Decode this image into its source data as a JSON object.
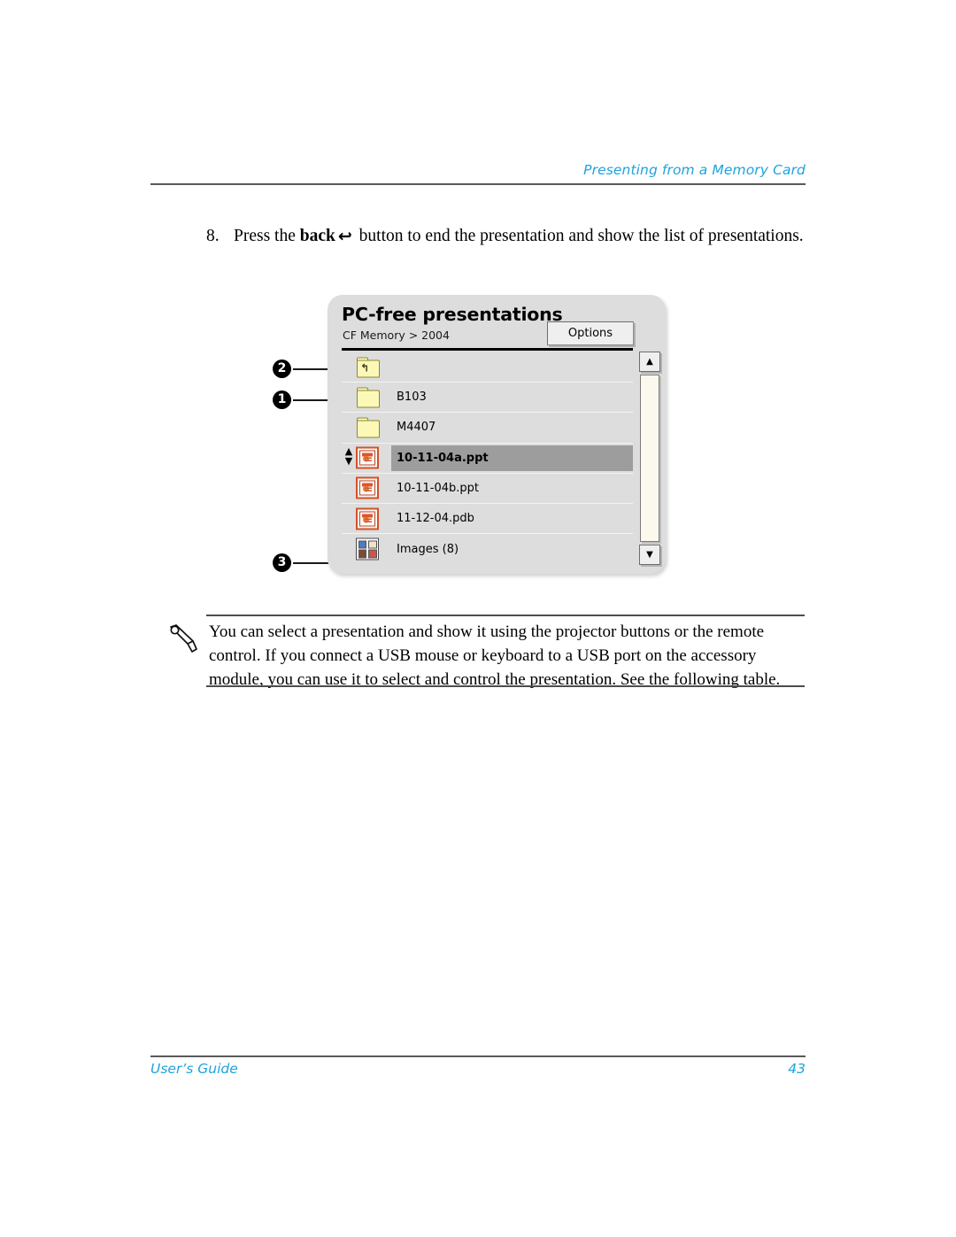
{
  "page": {
    "running_head": "Presenting from a Memory Card",
    "footer_left": "User’s Guide",
    "footer_page_number": "43",
    "accent_color": "#1fa3dd"
  },
  "step": {
    "number": "8.",
    "text_before": "Press the ",
    "bold_word": "back",
    "glyph": "↩",
    "icon_name": "back-arrow-icon",
    "text_after": " button to end the presentation and show the list of presentations."
  },
  "illustration": {
    "name": "pc-free-presentations-screen",
    "dialog": {
      "title": "PC-free presentations",
      "breadcrumb": "CF Memory > 2004",
      "options_button": "Options"
    },
    "callouts": [
      {
        "id": "1",
        "label": "❶",
        "target": "folder-row-b103"
      },
      {
        "id": "2",
        "label": "❷",
        "target": "parent-folder-row"
      },
      {
        "id": "3",
        "label": "❸",
        "target": "images-row"
      }
    ],
    "rows": [
      {
        "icon": "folder-up-icon",
        "label": "",
        "selected": false,
        "type": "folder-up"
      },
      {
        "icon": "folder-icon",
        "label": "B103",
        "selected": false,
        "type": "folder"
      },
      {
        "icon": "folder-icon",
        "label": "M4407",
        "selected": false,
        "type": "folder"
      },
      {
        "icon": "powerpoint-icon",
        "label": "10-11-04a.ppt",
        "selected": true,
        "type": "ppt"
      },
      {
        "icon": "powerpoint-icon",
        "label": "10-11-04b.ppt",
        "selected": false,
        "type": "ppt"
      },
      {
        "icon": "powerpoint-icon",
        "label": "11-12-04.pdb",
        "selected": false,
        "type": "ppt"
      },
      {
        "icon": "images-folder-icon",
        "label": "Images (8)",
        "selected": false,
        "type": "images"
      }
    ],
    "scrollbar": {
      "up_glyph": "▲",
      "down_glyph": "▼"
    },
    "selection_indicator": {
      "up_glyph": "▲",
      "down_glyph": "▼"
    },
    "colors": {
      "dialog_bg": "#dddddd",
      "selected_row": "#9d9d9d",
      "folder_fill": "#fbf8b8",
      "ppt_border": "#d4512a"
    }
  },
  "note": {
    "icon_name": "pencil-note-icon",
    "text": "You can select a presentation and show it using the projector buttons or the remote control. If you connect a USB mouse or keyboard to a USB port on the accessory module, you can use it to select and control the presentation. See the following table."
  }
}
